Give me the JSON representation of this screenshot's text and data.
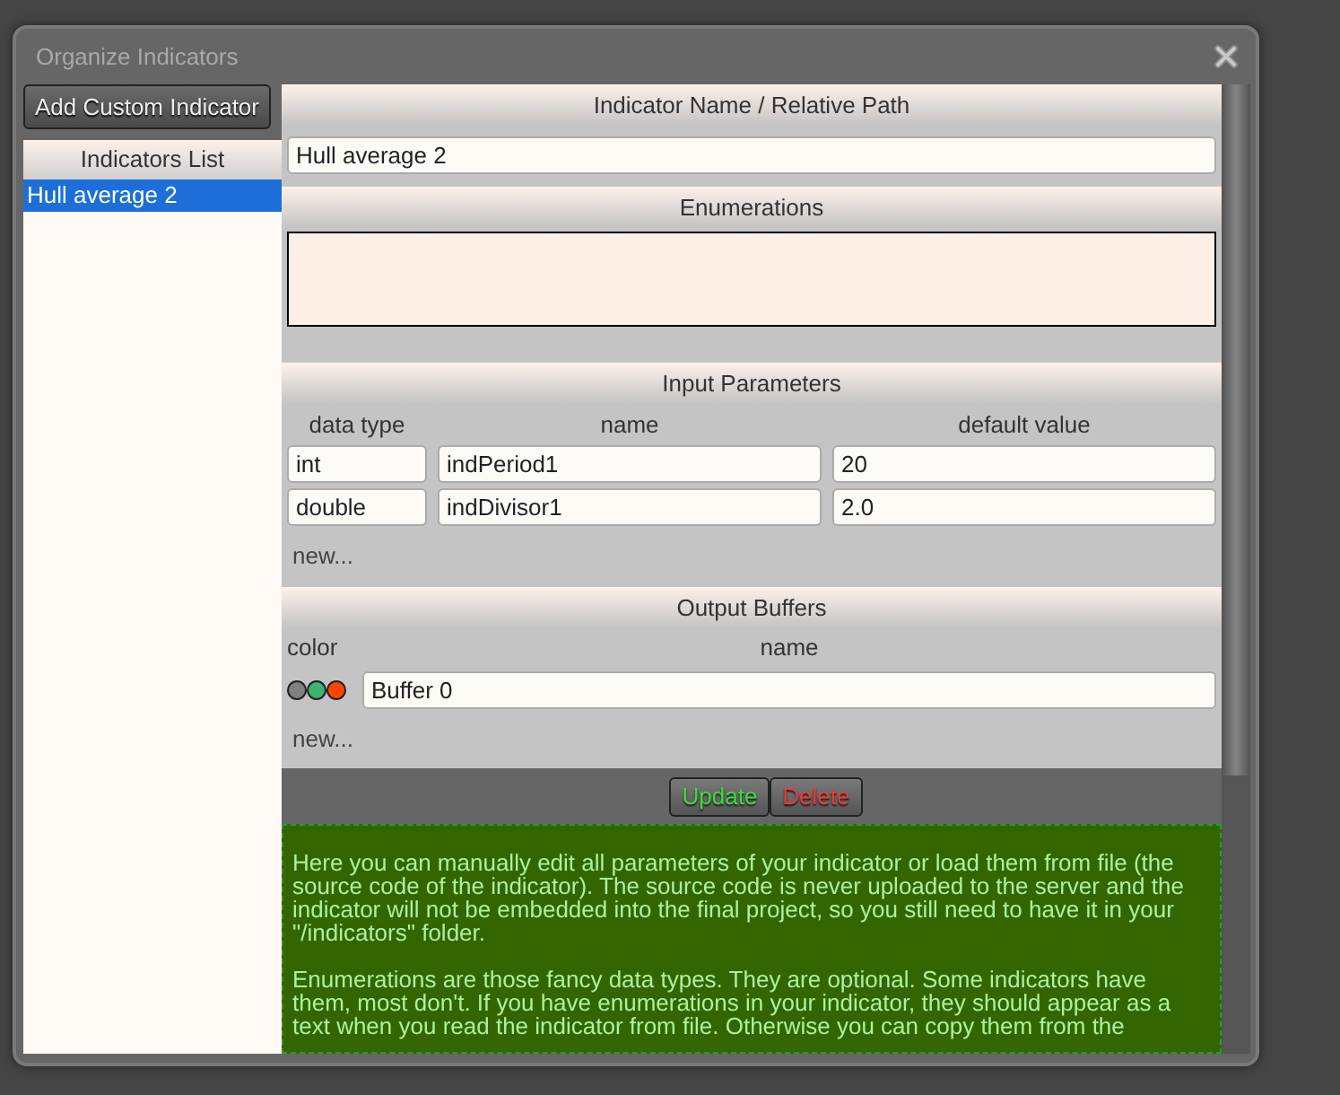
{
  "window": {
    "title": "Organize Indicators"
  },
  "sidebar": {
    "add_button": "Add Custom Indicator",
    "list_title": "Indicators List",
    "items": [
      {
        "label": "Hull average 2",
        "selected": true
      }
    ]
  },
  "name_section": {
    "title": "Indicator Name / Relative Path",
    "value": "Hull average 2"
  },
  "enumerations": {
    "title": "Enumerations"
  },
  "input_parameters": {
    "title": "Input Parameters",
    "columns": [
      "data type",
      "name",
      "default value"
    ],
    "rows": [
      {
        "data_type": "int",
        "name": "indPeriod1",
        "default_value": "20"
      },
      {
        "data_type": "double",
        "name": "indDivisor1",
        "default_value": "2.0"
      }
    ],
    "new_link": "new..."
  },
  "output_buffers": {
    "title": "Output Buffers",
    "columns": [
      "color",
      "name"
    ],
    "rows": [
      {
        "swatches": [
          {
            "color": "#808080"
          },
          {
            "color": "#3cb371"
          },
          {
            "color": "#ff4500"
          }
        ],
        "name": "Buffer 0"
      }
    ],
    "new_link": "new..."
  },
  "actions": [
    {
      "label": "Update",
      "kind": "update"
    },
    {
      "label": "Delete",
      "kind": "delete"
    }
  ],
  "help": {
    "paragraphs": [
      "Here you can manually edit all parameters of your indicator or load them from file (the source code of the indicator). The source code is never uploaded to the server and the indicator will not be embedded into the final project, so you still need to have it in your \"/indicators\" folder.",
      "Enumerations are those fancy data types. They are optional. Some indicators have them, most don't. If you have enumerations in your indicator, they should appear as a text when you read the indicator from file. Otherwise you can copy them from the"
    ]
  }
}
